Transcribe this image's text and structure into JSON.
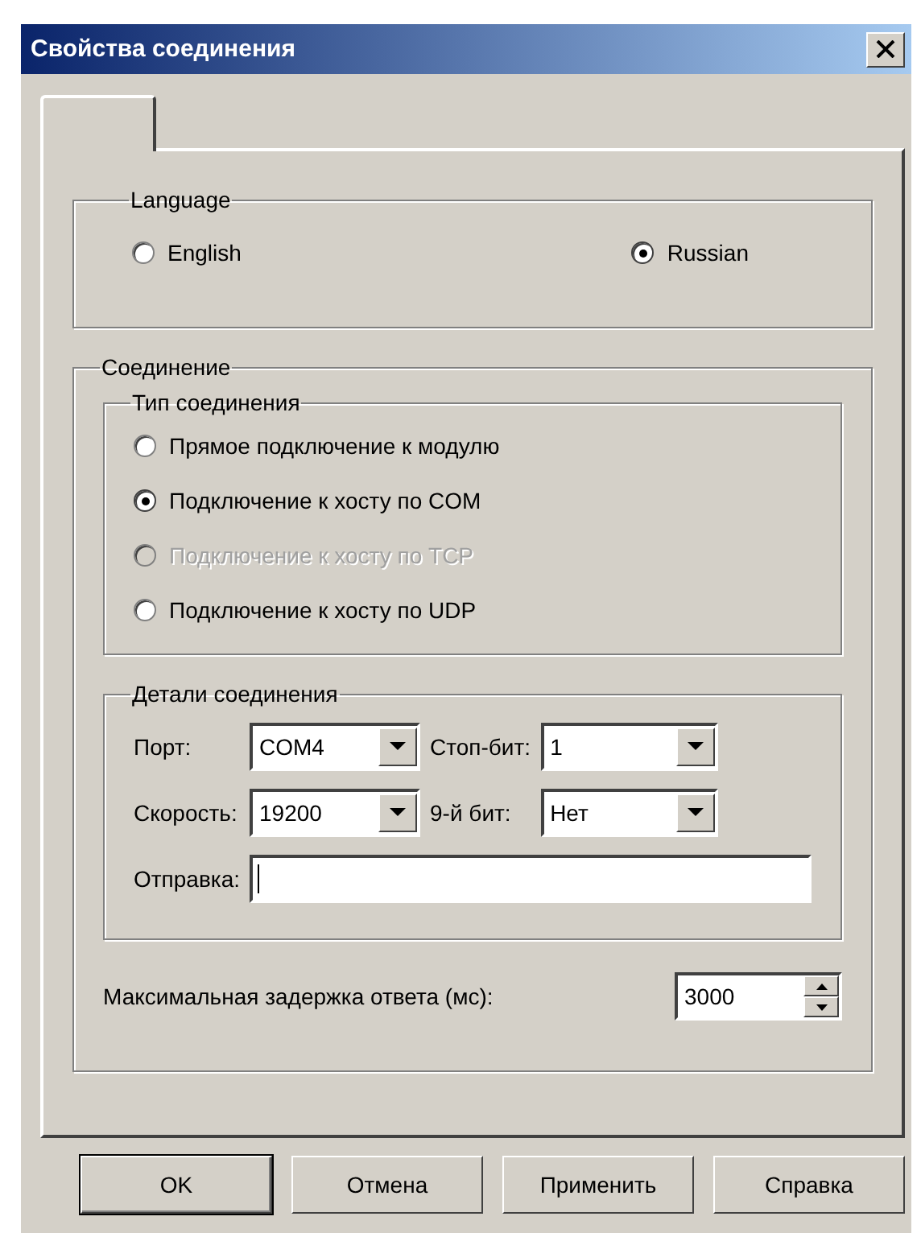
{
  "window": {
    "title": "Свойства соединения"
  },
  "language": {
    "title": "Language",
    "options": [
      {
        "label": "English",
        "selected": false
      },
      {
        "label": "Russian",
        "selected": true
      }
    ]
  },
  "connection": {
    "title": "Соединение",
    "type_group": {
      "title": "Тип соединения",
      "options": [
        {
          "label": "Прямое подключение к модулю",
          "selected": false,
          "disabled": false
        },
        {
          "label": "Подключение к хосту по COM",
          "selected": true,
          "disabled": false
        },
        {
          "label": "Подключение к хосту по TCP",
          "selected": false,
          "disabled": true
        },
        {
          "label": "Подключение к хосту по UDP",
          "selected": false,
          "disabled": false
        }
      ]
    },
    "details": {
      "title": "Детали соединения",
      "port": {
        "label": "Порт:",
        "value": "COM4"
      },
      "stop_bits": {
        "label": "Стоп-бит:",
        "value": "1"
      },
      "speed": {
        "label": "Скорость:",
        "value": "19200"
      },
      "ninth_bit": {
        "label": "9-й бит:",
        "value": "Нет"
      },
      "send": {
        "label": "Отправка:"
      }
    },
    "max_delay": {
      "label": "Максимальная задержка ответа (мс):",
      "value": "3000"
    }
  },
  "buttons": [
    {
      "label": "OK",
      "default": true
    },
    {
      "label": "Отмена",
      "default": false
    },
    {
      "label": "Применить",
      "default": false
    },
    {
      "label": "Справка",
      "default": false
    }
  ]
}
